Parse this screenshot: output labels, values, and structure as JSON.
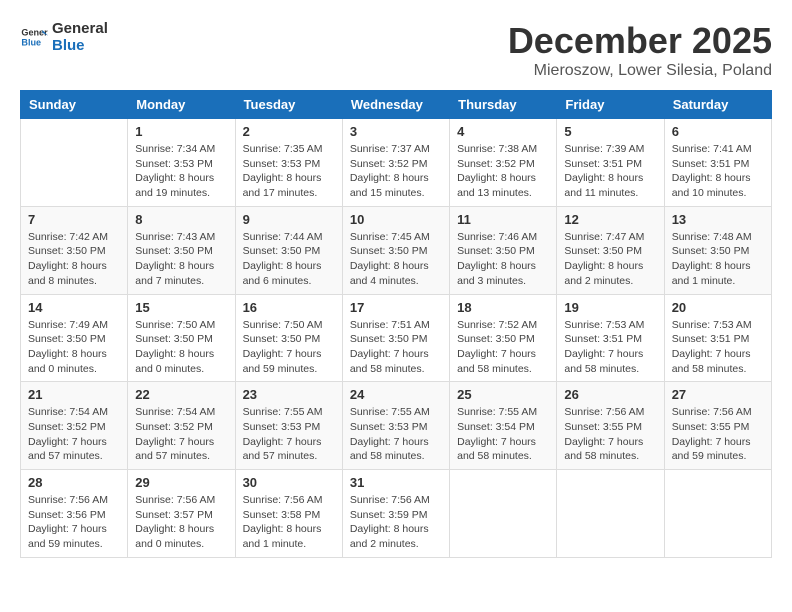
{
  "header": {
    "logo_line1": "General",
    "logo_line2": "Blue",
    "month": "December 2025",
    "location": "Mieroszow, Lower Silesia, Poland"
  },
  "weekdays": [
    "Sunday",
    "Monday",
    "Tuesday",
    "Wednesday",
    "Thursday",
    "Friday",
    "Saturday"
  ],
  "weeks": [
    [
      {
        "day": "",
        "info": ""
      },
      {
        "day": "1",
        "info": "Sunrise: 7:34 AM\nSunset: 3:53 PM\nDaylight: 8 hours\nand 19 minutes."
      },
      {
        "day": "2",
        "info": "Sunrise: 7:35 AM\nSunset: 3:53 PM\nDaylight: 8 hours\nand 17 minutes."
      },
      {
        "day": "3",
        "info": "Sunrise: 7:37 AM\nSunset: 3:52 PM\nDaylight: 8 hours\nand 15 minutes."
      },
      {
        "day": "4",
        "info": "Sunrise: 7:38 AM\nSunset: 3:52 PM\nDaylight: 8 hours\nand 13 minutes."
      },
      {
        "day": "5",
        "info": "Sunrise: 7:39 AM\nSunset: 3:51 PM\nDaylight: 8 hours\nand 11 minutes."
      },
      {
        "day": "6",
        "info": "Sunrise: 7:41 AM\nSunset: 3:51 PM\nDaylight: 8 hours\nand 10 minutes."
      }
    ],
    [
      {
        "day": "7",
        "info": "Sunrise: 7:42 AM\nSunset: 3:50 PM\nDaylight: 8 hours\nand 8 minutes."
      },
      {
        "day": "8",
        "info": "Sunrise: 7:43 AM\nSunset: 3:50 PM\nDaylight: 8 hours\nand 7 minutes."
      },
      {
        "day": "9",
        "info": "Sunrise: 7:44 AM\nSunset: 3:50 PM\nDaylight: 8 hours\nand 6 minutes."
      },
      {
        "day": "10",
        "info": "Sunrise: 7:45 AM\nSunset: 3:50 PM\nDaylight: 8 hours\nand 4 minutes."
      },
      {
        "day": "11",
        "info": "Sunrise: 7:46 AM\nSunset: 3:50 PM\nDaylight: 8 hours\nand 3 minutes."
      },
      {
        "day": "12",
        "info": "Sunrise: 7:47 AM\nSunset: 3:50 PM\nDaylight: 8 hours\nand 2 minutes."
      },
      {
        "day": "13",
        "info": "Sunrise: 7:48 AM\nSunset: 3:50 PM\nDaylight: 8 hours\nand 1 minute."
      }
    ],
    [
      {
        "day": "14",
        "info": "Sunrise: 7:49 AM\nSunset: 3:50 PM\nDaylight: 8 hours\nand 0 minutes."
      },
      {
        "day": "15",
        "info": "Sunrise: 7:50 AM\nSunset: 3:50 PM\nDaylight: 8 hours\nand 0 minutes."
      },
      {
        "day": "16",
        "info": "Sunrise: 7:50 AM\nSunset: 3:50 PM\nDaylight: 7 hours\nand 59 minutes."
      },
      {
        "day": "17",
        "info": "Sunrise: 7:51 AM\nSunset: 3:50 PM\nDaylight: 7 hours\nand 58 minutes."
      },
      {
        "day": "18",
        "info": "Sunrise: 7:52 AM\nSunset: 3:50 PM\nDaylight: 7 hours\nand 58 minutes."
      },
      {
        "day": "19",
        "info": "Sunrise: 7:53 AM\nSunset: 3:51 PM\nDaylight: 7 hours\nand 58 minutes."
      },
      {
        "day": "20",
        "info": "Sunrise: 7:53 AM\nSunset: 3:51 PM\nDaylight: 7 hours\nand 58 minutes."
      }
    ],
    [
      {
        "day": "21",
        "info": "Sunrise: 7:54 AM\nSunset: 3:52 PM\nDaylight: 7 hours\nand 57 minutes."
      },
      {
        "day": "22",
        "info": "Sunrise: 7:54 AM\nSunset: 3:52 PM\nDaylight: 7 hours\nand 57 minutes."
      },
      {
        "day": "23",
        "info": "Sunrise: 7:55 AM\nSunset: 3:53 PM\nDaylight: 7 hours\nand 57 minutes."
      },
      {
        "day": "24",
        "info": "Sunrise: 7:55 AM\nSunset: 3:53 PM\nDaylight: 7 hours\nand 58 minutes."
      },
      {
        "day": "25",
        "info": "Sunrise: 7:55 AM\nSunset: 3:54 PM\nDaylight: 7 hours\nand 58 minutes."
      },
      {
        "day": "26",
        "info": "Sunrise: 7:56 AM\nSunset: 3:55 PM\nDaylight: 7 hours\nand 58 minutes."
      },
      {
        "day": "27",
        "info": "Sunrise: 7:56 AM\nSunset: 3:55 PM\nDaylight: 7 hours\nand 59 minutes."
      }
    ],
    [
      {
        "day": "28",
        "info": "Sunrise: 7:56 AM\nSunset: 3:56 PM\nDaylight: 7 hours\nand 59 minutes."
      },
      {
        "day": "29",
        "info": "Sunrise: 7:56 AM\nSunset: 3:57 PM\nDaylight: 8 hours\nand 0 minutes."
      },
      {
        "day": "30",
        "info": "Sunrise: 7:56 AM\nSunset: 3:58 PM\nDaylight: 8 hours\nand 1 minute."
      },
      {
        "day": "31",
        "info": "Sunrise: 7:56 AM\nSunset: 3:59 PM\nDaylight: 8 hours\nand 2 minutes."
      },
      {
        "day": "",
        "info": ""
      },
      {
        "day": "",
        "info": ""
      },
      {
        "day": "",
        "info": ""
      }
    ]
  ]
}
